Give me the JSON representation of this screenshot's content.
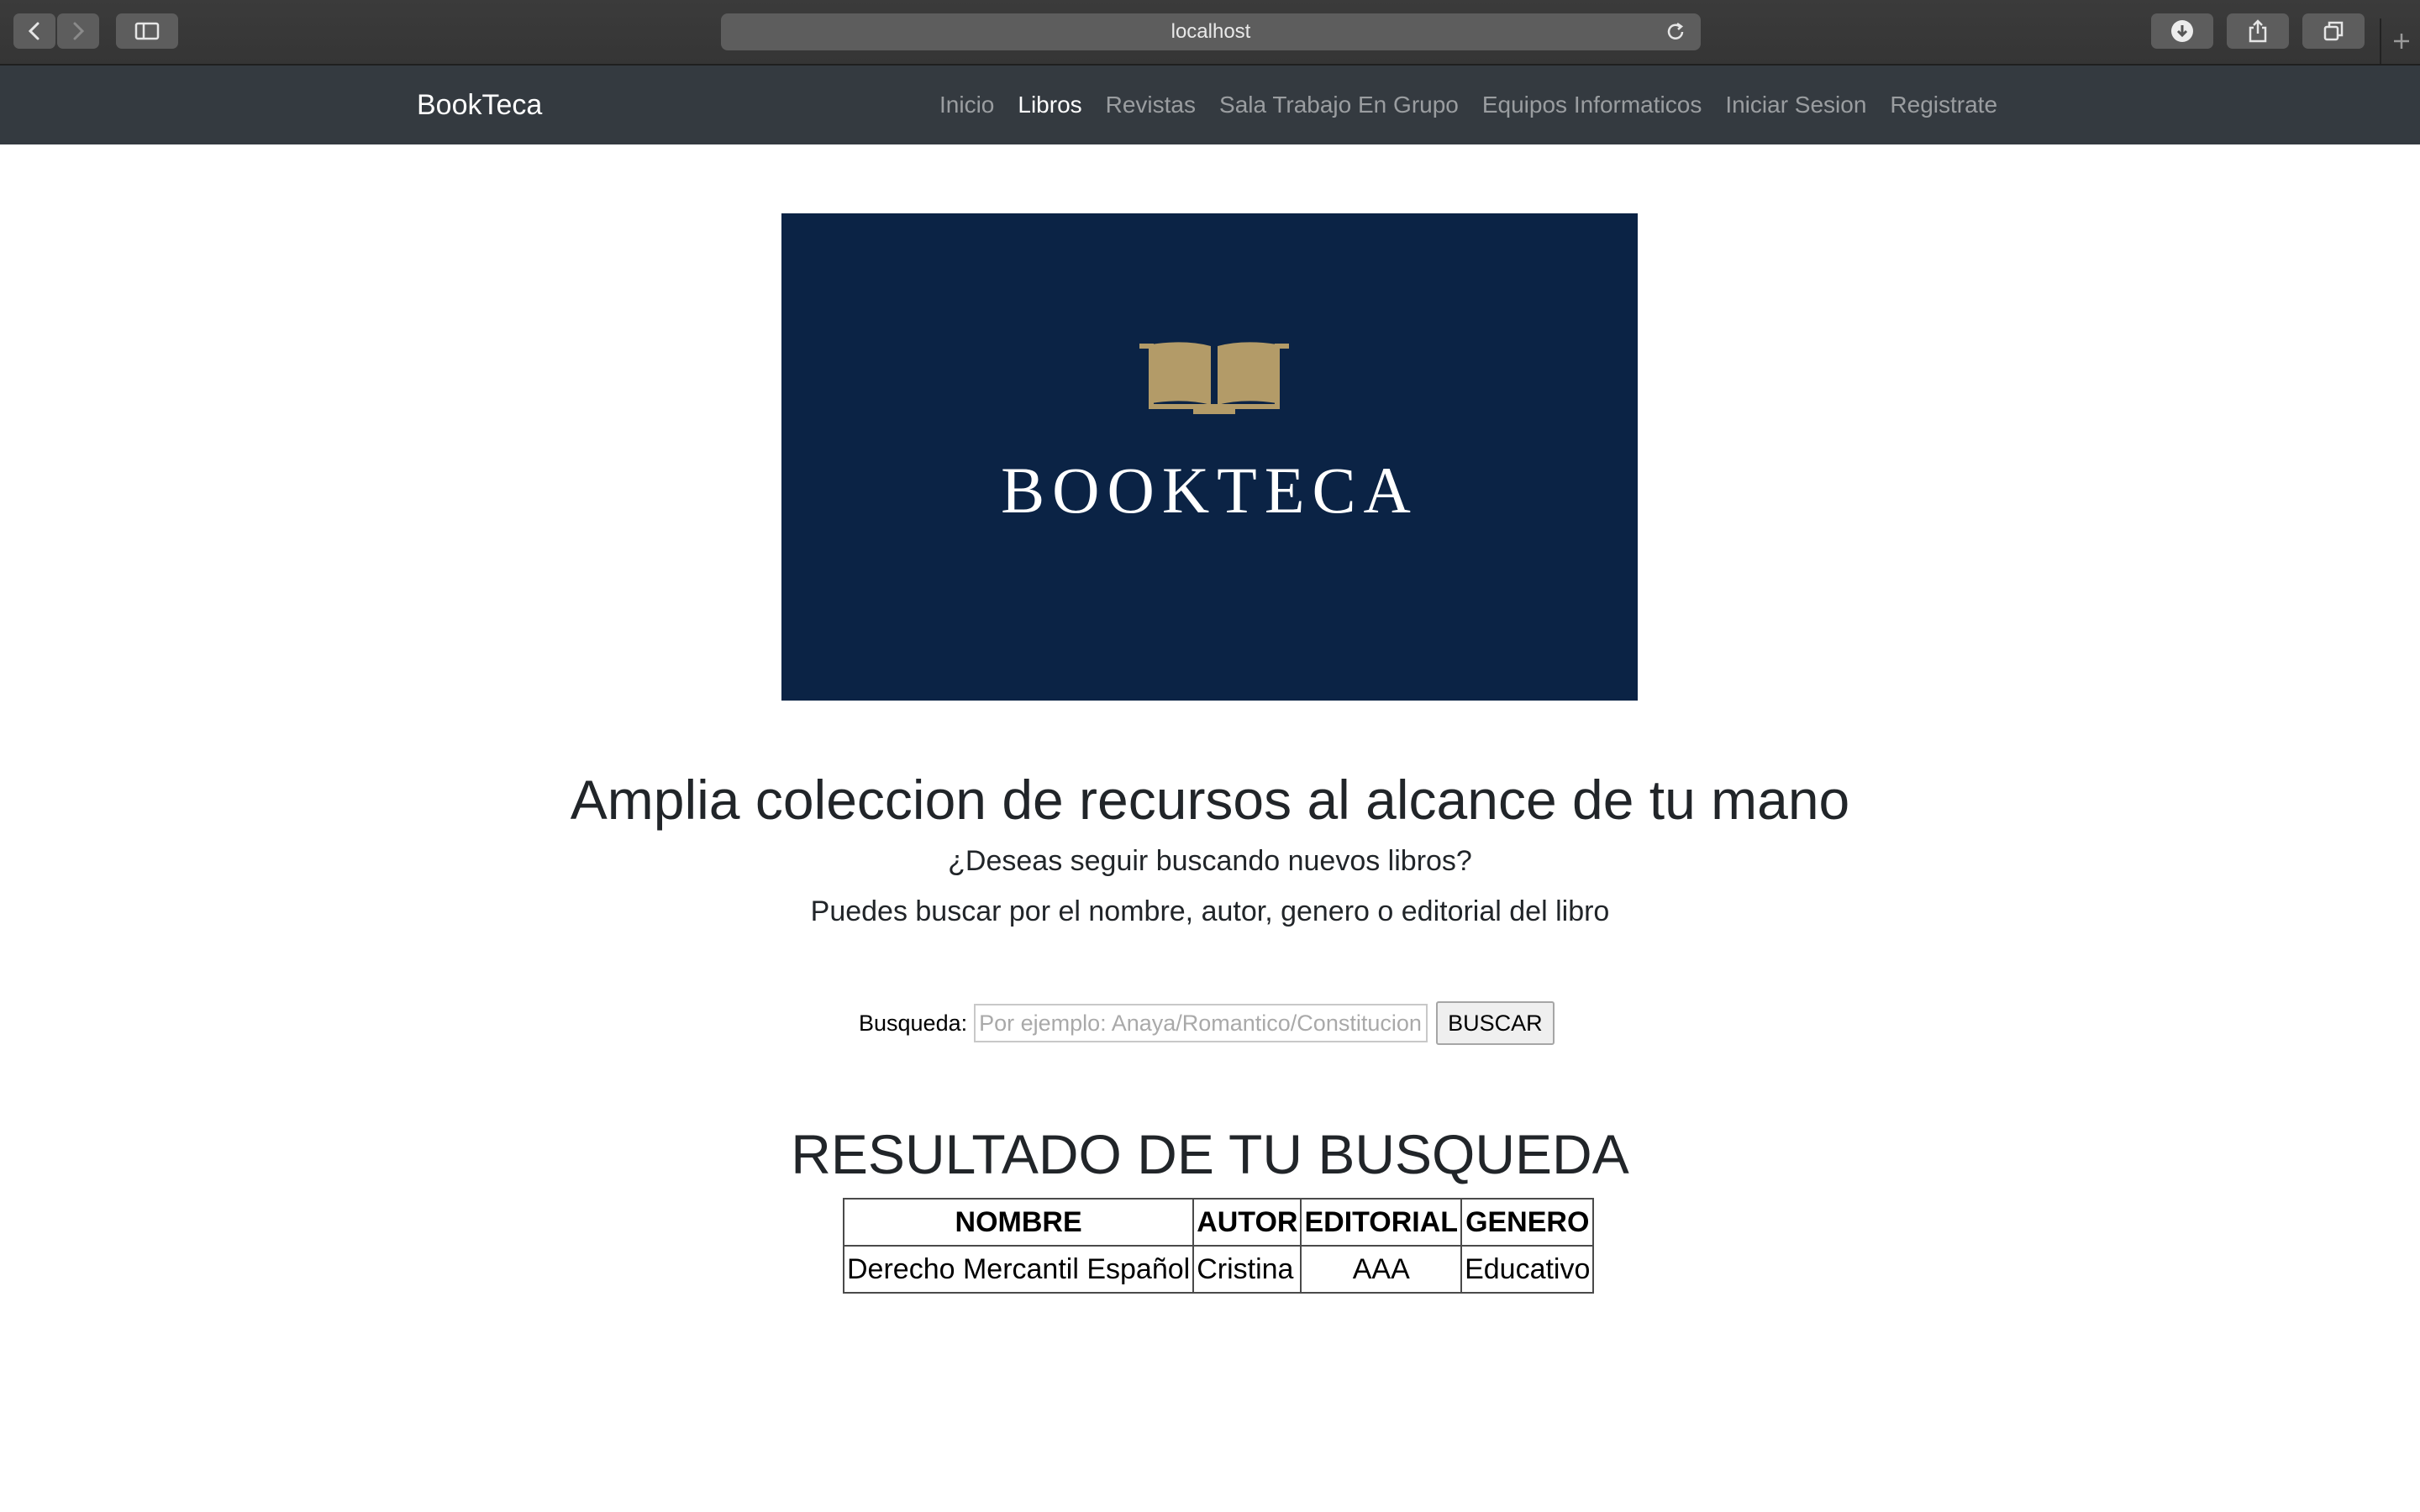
{
  "browser": {
    "url": "localhost"
  },
  "navbar": {
    "brand": "BookTeca",
    "links": [
      "Inicio",
      "Libros",
      "Revistas",
      "Sala Trabajo En Grupo",
      "Equipos Informaticos",
      "Iniciar Sesion",
      "Registrate"
    ],
    "active": "Libros"
  },
  "banner": {
    "logo_text": "BOOKTECA",
    "background_color": "#0b2345",
    "icon_color": "#b39b68"
  },
  "hero": {
    "title": "Amplia coleccion de recursos al alcance de tu mano",
    "question": "¿Deseas seguir buscando nuevos libros?",
    "hint": "Puedes buscar por el nombre, autor, genero o editorial del libro"
  },
  "search": {
    "label": "Busqueda:",
    "placeholder": "Por ejemplo: Anaya/Romantico/Constitucion",
    "value": "",
    "button_label": "BUSCAR"
  },
  "results": {
    "title": "RESULTADO DE TU BUSQUEDA",
    "columns": [
      "NOMBRE",
      "AUTOR",
      "EDITORIAL",
      "GENERO"
    ],
    "rows": [
      [
        "Derecho Mercantil Español",
        "Cristina",
        "AAA",
        "Educativo"
      ]
    ]
  }
}
